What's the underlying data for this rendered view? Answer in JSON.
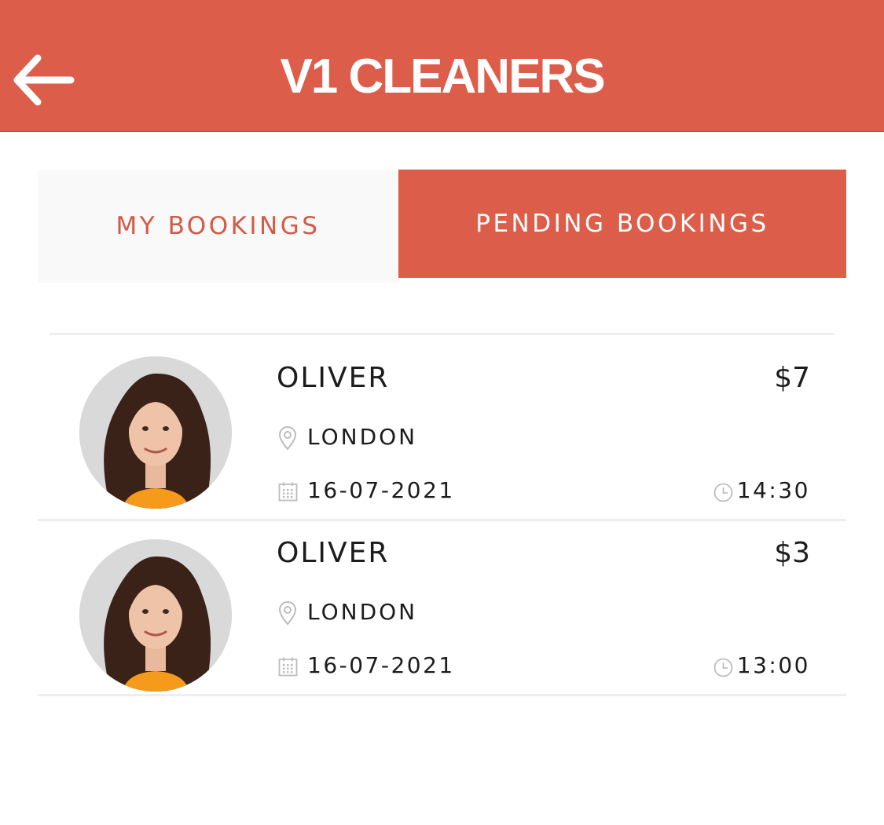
{
  "header": {
    "title": "V1 CLEANERS",
    "back_icon": "arrow-left-icon",
    "background_color": "#dc5e4a"
  },
  "tabs": [
    {
      "label": "MY BOOKINGS",
      "active": false
    },
    {
      "label": "PENDING BOOKINGS",
      "active": true
    }
  ],
  "bookings": [
    {
      "name": "OLIVER",
      "price": "$7",
      "location": "LONDON",
      "date": "16-07-2021",
      "time": "14:30",
      "avatar": "woman-portrait-avatar"
    },
    {
      "name": "OLIVER",
      "price": "$3",
      "location": "LONDON",
      "date": "16-07-2021",
      "time": "13:00",
      "avatar": "woman-portrait-avatar"
    }
  ],
  "colors": {
    "accent": "#dc5e4a",
    "inactive_tab_bg": "#f9f9f9",
    "divider": "#eeeeee"
  }
}
